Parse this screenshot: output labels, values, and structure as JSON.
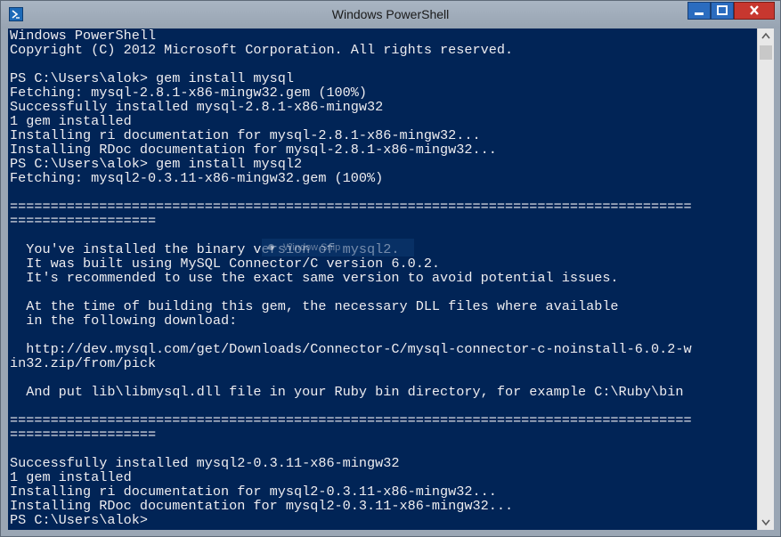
{
  "window": {
    "title": "Windows PowerShell"
  },
  "console": {
    "lines": [
      "Windows PowerShell",
      "Copyright (C) 2012 Microsoft Corporation. All rights reserved.",
      "",
      "PS C:\\Users\\alok> gem install mysql",
      "Fetching: mysql-2.8.1-x86-mingw32.gem (100%)",
      "Successfully installed mysql-2.8.1-x86-mingw32",
      "1 gem installed",
      "Installing ri documentation for mysql-2.8.1-x86-mingw32...",
      "Installing RDoc documentation for mysql-2.8.1-x86-mingw32...",
      "PS C:\\Users\\alok> gem install mysql2",
      "Fetching: mysql2-0.3.11-x86-mingw32.gem (100%)",
      "",
      "====================================================================================",
      "==================",
      "",
      "  You've installed the binary version of mysql2.",
      "  It was built using MySQL Connector/C version 6.0.2.",
      "  It's recommended to use the exact same version to avoid potential issues.",
      "",
      "  At the time of building this gem, the necessary DLL files where available",
      "  in the following download:",
      "",
      "  http://dev.mysql.com/get/Downloads/Connector-C/mysql-connector-c-noinstall-6.0.2-w",
      "in32.zip/from/pick",
      "",
      "  And put lib\\libmysql.dll file in your Ruby bin directory, for example C:\\Ruby\\bin",
      "",
      "====================================================================================",
      "==================",
      "",
      "Successfully installed mysql2-0.3.11-x86-mingw32",
      "1 gem installed",
      "Installing ri documentation for mysql2-0.3.11-x86-mingw32...",
      "Installing RDoc documentation for mysql2-0.3.11-x86-mingw32...",
      "PS C:\\Users\\alok>"
    ]
  },
  "overlay": {
    "snip_label": "Window Snip"
  },
  "colors": {
    "console_bg": "#012456",
    "console_fg": "#eeedf0",
    "close": "#c7372f",
    "title_button": "#2b6cbf"
  },
  "icons": [
    "powershell-icon",
    "minimize-icon",
    "maximize-icon",
    "close-icon",
    "scroll-up-arrow-icon",
    "scroll-down-arrow-icon"
  ]
}
